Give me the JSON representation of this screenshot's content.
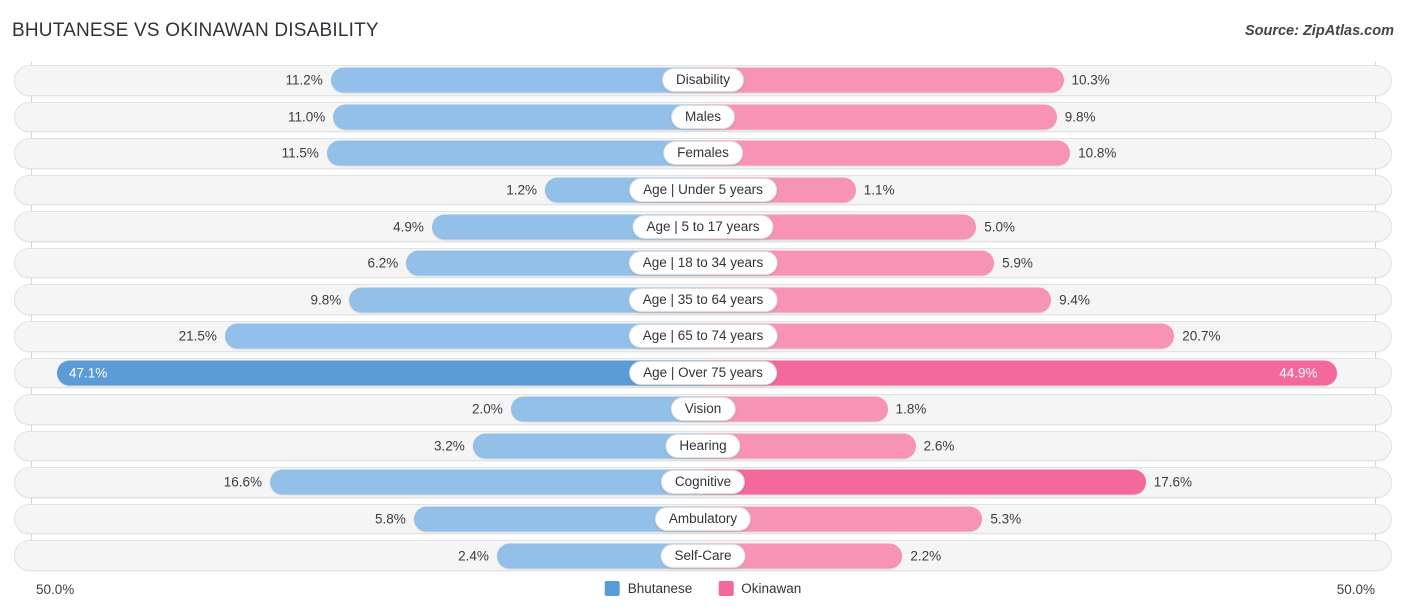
{
  "header": {
    "title": "BHUTANESE VS OKINAWAN DISABILITY",
    "source": "Source: ZipAtlas.com"
  },
  "axis": {
    "left_label": "50.0%",
    "right_label": "50.0%",
    "max": 50.0
  },
  "legend": {
    "items": [
      {
        "label": "Bhutanese",
        "color": "#5b9bd8"
      },
      {
        "label": "Okinawan",
        "color": "#f4699b"
      }
    ]
  },
  "colors": {
    "left_normal": "#92c0e9",
    "left_highlight": "#5b9bd8",
    "right_normal": "#f793b5",
    "right_highlight": "#f4699b",
    "track": "#f5f5f5",
    "gridline": "#d8d8d8"
  },
  "chart_data": {
    "type": "bar",
    "title": "BHUTANESE VS OKINAWAN DISABILITY",
    "subtitle": "Source: ZipAtlas.com",
    "orientation": "horizontal-diverging",
    "xlabel": "",
    "ylabel": "",
    "xlim": [
      50.0,
      50.0
    ],
    "grid": true,
    "legend_position": "bottom-center",
    "categories": [
      "Disability",
      "Males",
      "Females",
      "Age | Under 5 years",
      "Age | 5 to 17 years",
      "Age | 18 to 34 years",
      "Age | 35 to 64 years",
      "Age | 65 to 74 years",
      "Age | Over 75 years",
      "Vision",
      "Hearing",
      "Cognitive",
      "Ambulatory",
      "Self-Care"
    ],
    "series": [
      {
        "name": "Bhutanese",
        "side": "left",
        "color": "#92c0e9",
        "values": [
          11.2,
          11.0,
          11.5,
          1.2,
          4.9,
          6.2,
          9.8,
          21.5,
          47.1,
          2.0,
          3.2,
          16.6,
          5.8,
          2.4
        ],
        "labels": [
          "11.2%",
          "11.0%",
          "11.5%",
          "1.2%",
          "4.9%",
          "6.2%",
          "9.8%",
          "21.5%",
          "47.1%",
          "2.0%",
          "3.2%",
          "16.6%",
          "5.8%",
          "2.4%"
        ]
      },
      {
        "name": "Okinawan",
        "side": "right",
        "color": "#f793b5",
        "values": [
          10.3,
          9.8,
          10.8,
          1.1,
          5.0,
          5.9,
          9.4,
          20.7,
          44.9,
          1.8,
          2.6,
          17.6,
          5.3,
          2.2
        ],
        "labels": [
          "10.3%",
          "9.8%",
          "10.8%",
          "1.1%",
          "5.0%",
          "5.9%",
          "9.4%",
          "20.7%",
          "44.9%",
          "1.8%",
          "2.6%",
          "17.6%",
          "5.3%",
          "2.2%"
        ]
      }
    ],
    "highlight_rows": [
      8
    ],
    "highlight_cells": {
      "left": [
        8
      ],
      "right": [
        8,
        11
      ]
    }
  }
}
